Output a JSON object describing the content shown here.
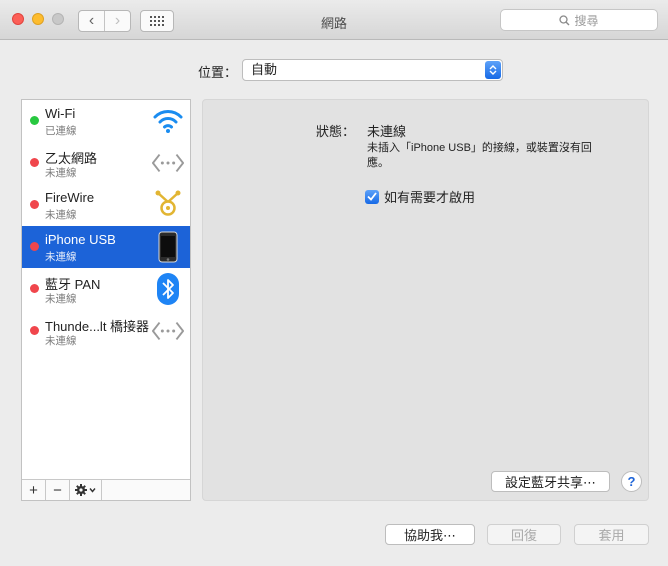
{
  "window": {
    "title": "網路"
  },
  "search": {
    "placeholder": "搜尋"
  },
  "location": {
    "label": "位置：",
    "value": "自動"
  },
  "services": [
    {
      "name": "Wi-Fi",
      "status": "已連線",
      "dot_color": "#28c840",
      "icon": "wifi-icon"
    },
    {
      "name": "乙太網路",
      "status": "未連線",
      "dot_color": "#f0464c",
      "icon": "ethernet-icon"
    },
    {
      "name": "FireWire",
      "status": "未連線",
      "dot_color": "#f0464c",
      "icon": "firewire-icon"
    },
    {
      "name": "iPhone USB",
      "status": "未連線",
      "dot_color": "#f0464c",
      "icon": "iphone-icon"
    },
    {
      "name": "藍牙 PAN",
      "status": "未連線",
      "dot_color": "#f0464c",
      "icon": "bluetooth-icon"
    },
    {
      "name": "Thunde...lt 橋接器",
      "status": "未連線",
      "dot_color": "#f0464c",
      "icon": "thunderbolt-bridge-icon"
    }
  ],
  "detail": {
    "status_label": "狀態：",
    "status_value": "未連線",
    "status_desc": "未插入「iPhone USB」的接線，或裝置沒有回應。",
    "auto_enable_label": "如有需要才啟用",
    "bluetooth_share_button": "設定藍牙共享⋯",
    "help_button": "?"
  },
  "bottom": {
    "assist_button": "協助我⋯",
    "revert_button": "回復",
    "apply_button": "套用"
  },
  "sidebar_controls": {
    "add": "+",
    "remove": "−"
  },
  "colors": {
    "accent": "#1c63d8"
  }
}
